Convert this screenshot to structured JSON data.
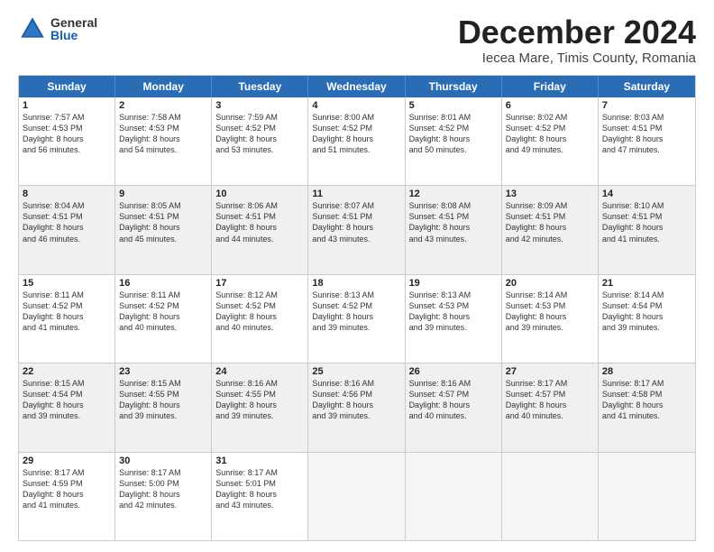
{
  "logo": {
    "general": "General",
    "blue": "Blue"
  },
  "title": {
    "month": "December 2024",
    "location": "Iecea Mare, Timis County, Romania"
  },
  "weekdays": [
    "Sunday",
    "Monday",
    "Tuesday",
    "Wednesday",
    "Thursday",
    "Friday",
    "Saturday"
  ],
  "rows": [
    [
      {
        "day": "1",
        "lines": [
          "Sunrise: 7:57 AM",
          "Sunset: 4:53 PM",
          "Daylight: 8 hours",
          "and 56 minutes."
        ]
      },
      {
        "day": "2",
        "lines": [
          "Sunrise: 7:58 AM",
          "Sunset: 4:53 PM",
          "Daylight: 8 hours",
          "and 54 minutes."
        ]
      },
      {
        "day": "3",
        "lines": [
          "Sunrise: 7:59 AM",
          "Sunset: 4:52 PM",
          "Daylight: 8 hours",
          "and 53 minutes."
        ]
      },
      {
        "day": "4",
        "lines": [
          "Sunrise: 8:00 AM",
          "Sunset: 4:52 PM",
          "Daylight: 8 hours",
          "and 51 minutes."
        ]
      },
      {
        "day": "5",
        "lines": [
          "Sunrise: 8:01 AM",
          "Sunset: 4:52 PM",
          "Daylight: 8 hours",
          "and 50 minutes."
        ]
      },
      {
        "day": "6",
        "lines": [
          "Sunrise: 8:02 AM",
          "Sunset: 4:52 PM",
          "Daylight: 8 hours",
          "and 49 minutes."
        ]
      },
      {
        "day": "7",
        "lines": [
          "Sunrise: 8:03 AM",
          "Sunset: 4:51 PM",
          "Daylight: 8 hours",
          "and 47 minutes."
        ]
      }
    ],
    [
      {
        "day": "8",
        "lines": [
          "Sunrise: 8:04 AM",
          "Sunset: 4:51 PM",
          "Daylight: 8 hours",
          "and 46 minutes."
        ]
      },
      {
        "day": "9",
        "lines": [
          "Sunrise: 8:05 AM",
          "Sunset: 4:51 PM",
          "Daylight: 8 hours",
          "and 45 minutes."
        ]
      },
      {
        "day": "10",
        "lines": [
          "Sunrise: 8:06 AM",
          "Sunset: 4:51 PM",
          "Daylight: 8 hours",
          "and 44 minutes."
        ]
      },
      {
        "day": "11",
        "lines": [
          "Sunrise: 8:07 AM",
          "Sunset: 4:51 PM",
          "Daylight: 8 hours",
          "and 43 minutes."
        ]
      },
      {
        "day": "12",
        "lines": [
          "Sunrise: 8:08 AM",
          "Sunset: 4:51 PM",
          "Daylight: 8 hours",
          "and 43 minutes."
        ]
      },
      {
        "day": "13",
        "lines": [
          "Sunrise: 8:09 AM",
          "Sunset: 4:51 PM",
          "Daylight: 8 hours",
          "and 42 minutes."
        ]
      },
      {
        "day": "14",
        "lines": [
          "Sunrise: 8:10 AM",
          "Sunset: 4:51 PM",
          "Daylight: 8 hours",
          "and 41 minutes."
        ]
      }
    ],
    [
      {
        "day": "15",
        "lines": [
          "Sunrise: 8:11 AM",
          "Sunset: 4:52 PM",
          "Daylight: 8 hours",
          "and 41 minutes."
        ]
      },
      {
        "day": "16",
        "lines": [
          "Sunrise: 8:11 AM",
          "Sunset: 4:52 PM",
          "Daylight: 8 hours",
          "and 40 minutes."
        ]
      },
      {
        "day": "17",
        "lines": [
          "Sunrise: 8:12 AM",
          "Sunset: 4:52 PM",
          "Daylight: 8 hours",
          "and 40 minutes."
        ]
      },
      {
        "day": "18",
        "lines": [
          "Sunrise: 8:13 AM",
          "Sunset: 4:52 PM",
          "Daylight: 8 hours",
          "and 39 minutes."
        ]
      },
      {
        "day": "19",
        "lines": [
          "Sunrise: 8:13 AM",
          "Sunset: 4:53 PM",
          "Daylight: 8 hours",
          "and 39 minutes."
        ]
      },
      {
        "day": "20",
        "lines": [
          "Sunrise: 8:14 AM",
          "Sunset: 4:53 PM",
          "Daylight: 8 hours",
          "and 39 minutes."
        ]
      },
      {
        "day": "21",
        "lines": [
          "Sunrise: 8:14 AM",
          "Sunset: 4:54 PM",
          "Daylight: 8 hours",
          "and 39 minutes."
        ]
      }
    ],
    [
      {
        "day": "22",
        "lines": [
          "Sunrise: 8:15 AM",
          "Sunset: 4:54 PM",
          "Daylight: 8 hours",
          "and 39 minutes."
        ]
      },
      {
        "day": "23",
        "lines": [
          "Sunrise: 8:15 AM",
          "Sunset: 4:55 PM",
          "Daylight: 8 hours",
          "and 39 minutes."
        ]
      },
      {
        "day": "24",
        "lines": [
          "Sunrise: 8:16 AM",
          "Sunset: 4:55 PM",
          "Daylight: 8 hours",
          "and 39 minutes."
        ]
      },
      {
        "day": "25",
        "lines": [
          "Sunrise: 8:16 AM",
          "Sunset: 4:56 PM",
          "Daylight: 8 hours",
          "and 39 minutes."
        ]
      },
      {
        "day": "26",
        "lines": [
          "Sunrise: 8:16 AM",
          "Sunset: 4:57 PM",
          "Daylight: 8 hours",
          "and 40 minutes."
        ]
      },
      {
        "day": "27",
        "lines": [
          "Sunrise: 8:17 AM",
          "Sunset: 4:57 PM",
          "Daylight: 8 hours",
          "and 40 minutes."
        ]
      },
      {
        "day": "28",
        "lines": [
          "Sunrise: 8:17 AM",
          "Sunset: 4:58 PM",
          "Daylight: 8 hours",
          "and 41 minutes."
        ]
      }
    ],
    [
      {
        "day": "29",
        "lines": [
          "Sunrise: 8:17 AM",
          "Sunset: 4:59 PM",
          "Daylight: 8 hours",
          "and 41 minutes."
        ]
      },
      {
        "day": "30",
        "lines": [
          "Sunrise: 8:17 AM",
          "Sunset: 5:00 PM",
          "Daylight: 8 hours",
          "and 42 minutes."
        ]
      },
      {
        "day": "31",
        "lines": [
          "Sunrise: 8:17 AM",
          "Sunset: 5:01 PM",
          "Daylight: 8 hours",
          "and 43 minutes."
        ]
      },
      {
        "day": "",
        "lines": []
      },
      {
        "day": "",
        "lines": []
      },
      {
        "day": "",
        "lines": []
      },
      {
        "day": "",
        "lines": []
      }
    ]
  ]
}
